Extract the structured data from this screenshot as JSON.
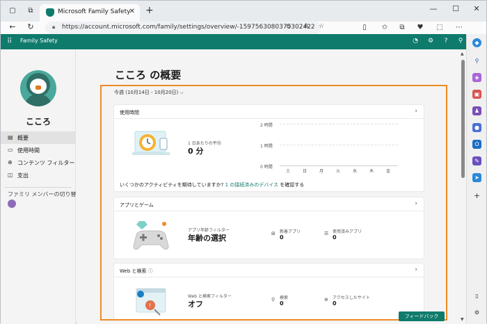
{
  "browser": {
    "tab_title": "Microsoft Family Safety",
    "url": "https://account.microsoft.com/family/settings/overview/-1597563080375302422"
  },
  "app": {
    "title": "Family Safety"
  },
  "profile": {
    "name": "こころ"
  },
  "nav": {
    "items": [
      {
        "label": "概要",
        "icon": "overview-icon",
        "active": true
      },
      {
        "label": "使用時間",
        "icon": "clock-icon",
        "active": false
      },
      {
        "label": "コンテンツ フィルター",
        "icon": "filter-icon",
        "active": false
      },
      {
        "label": "支出",
        "icon": "wallet-icon",
        "active": false
      }
    ],
    "switch_member_label": "ファミリ メンバーの切り替え"
  },
  "page": {
    "title": "こころ の概要",
    "week_selector": "今週 (10月14日 - 10月20日)"
  },
  "screen_time": {
    "title": "使用時間",
    "avg_label": "1 日あたりの平均",
    "avg_value": "0 分",
    "footer_text": "いくつかのアクティビティを期待していますか?",
    "footer_link": "1 の接続済みのデバイス",
    "footer_suffix": "を確認する",
    "chart_y_labels": [
      "2 時間",
      "1 時間",
      "0 時間"
    ],
    "chart_x_labels": [
      "土",
      "日",
      "月",
      "火",
      "水",
      "木",
      "金"
    ]
  },
  "apps_games": {
    "title": "アプリとゲーム",
    "filter_label": "アプリ年齢フィルター",
    "filter_value": "年齢の選択",
    "new_apps_label": "新着アプリ",
    "new_apps_value": "0",
    "used_apps_label": "使用済みアプリ",
    "used_apps_value": "0"
  },
  "web_search": {
    "title": "Web と検索",
    "filter_label": "Web と検索フィルター",
    "filter_value": "オフ",
    "search_label": "検索",
    "search_value": "0",
    "sites_label": "アクセスしたサイト",
    "sites_value": "0"
  },
  "feedback_label": "フィードバック",
  "colors": {
    "brand": "#0f7b6c",
    "highlight": "#f08a24"
  }
}
